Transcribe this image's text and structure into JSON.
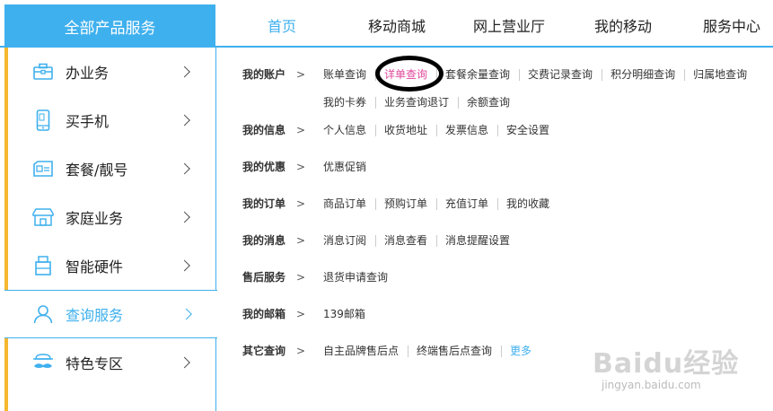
{
  "header": {
    "all_products": "全部产品服务",
    "nav": [
      {
        "label": "首页",
        "active": true
      },
      {
        "label": "移动商城",
        "active": false
      },
      {
        "label": "网上营业厅",
        "active": false
      },
      {
        "label": "我的移动",
        "active": false
      },
      {
        "label": "服务中心",
        "active": false
      }
    ]
  },
  "sidebar": {
    "items": [
      {
        "label": "办业务",
        "icon": "briefcase-icon"
      },
      {
        "label": "买手机",
        "icon": "phone-icon"
      },
      {
        "label": "套餐/靓号",
        "icon": "sim-card-icon"
      },
      {
        "label": "家庭业务",
        "icon": "house-icon"
      },
      {
        "label": "智能硬件",
        "icon": "usb-device-icon"
      },
      {
        "label": "查询服务",
        "icon": "user-icon",
        "active": true
      },
      {
        "label": "特色专区",
        "icon": "mustache-icon"
      }
    ]
  },
  "arrow": ">",
  "rows": [
    {
      "label": "我的账户",
      "links": [
        "账单查询",
        "详单查询",
        "套餐余量查询",
        "交费记录查询",
        "积分明细查询",
        "归属地查询",
        "我的卡券",
        "业务查询退订",
        "余额查询"
      ]
    },
    {
      "label": "我的信息",
      "links": [
        "个人信息",
        "收货地址",
        "发票信息",
        "安全设置"
      ]
    },
    {
      "label": "我的优惠",
      "links": [
        "优惠促销"
      ]
    },
    {
      "label": "我的订单",
      "links": [
        "商品订单",
        "预购订单",
        "充值订单",
        "我的收藏"
      ]
    },
    {
      "label": "我的消息",
      "links": [
        "消息订阅",
        "消息查看",
        "消息提醒设置"
      ]
    },
    {
      "label": "售后服务",
      "links": [
        "退货申请查询"
      ]
    },
    {
      "label": "我的邮箱",
      "links": [
        "139邮箱"
      ]
    },
    {
      "label": "其它查询",
      "links": [
        "自主品牌售后点",
        "终端售后点查询",
        "更多"
      ]
    }
  ],
  "watermark": {
    "main": "Baidu经验",
    "sub": "jingyan.baidu.com"
  },
  "colors": {
    "accent": "#3fb0ee",
    "highlight": "#e0479b",
    "sidebar_edge": "#f5b82e"
  }
}
